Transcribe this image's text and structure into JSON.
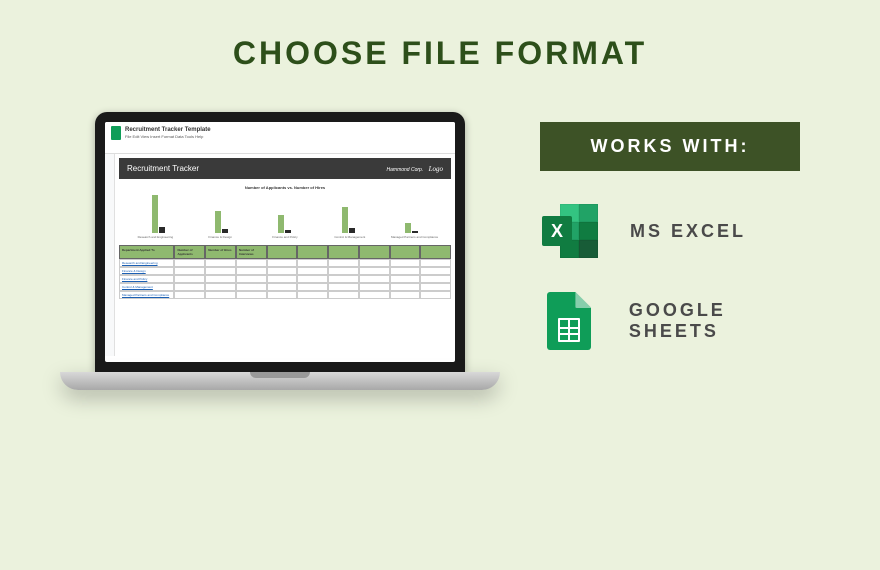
{
  "title": "CHOOSE FILE FORMAT",
  "works_with_label": "WORKS WITH:",
  "formats": {
    "excel": {
      "label": "MS EXCEL",
      "icon_letter": "X"
    },
    "sheets": {
      "label": "GOOGLE SHEETS"
    }
  },
  "laptop": {
    "app": {
      "doc_title": "Recruitment Tracker Template",
      "menus": "File  Edit  View  Insert  Format  Data  Tools  Help"
    },
    "tracker": {
      "header_title": "Recruitment Tracker",
      "company": "Hammond Corp.",
      "logo_text": "Logo"
    },
    "chart": {
      "title": "Number of Applicants vs. Number of Hires",
      "categories": [
        "Research and Engineering",
        "Finance & Design",
        "Finance and Policy",
        "Control & Management",
        "Managed Partners and Compliance"
      ]
    },
    "table": {
      "head_first": "Department Applied To",
      "head_cols": [
        "Number of Applicants",
        "Number of Hires",
        "Number of Interviews",
        "",
        "",
        "",
        "",
        "",
        ""
      ],
      "rows": [
        "Research and Engineering",
        "Finance & Design",
        "Finance and Policy",
        "Control & Management",
        "Managed Partners and Compliance"
      ]
    }
  },
  "bars": [
    [
      38,
      6
    ],
    [
      22,
      4
    ],
    [
      18,
      3
    ],
    [
      26,
      5
    ],
    [
      10,
      2
    ]
  ]
}
